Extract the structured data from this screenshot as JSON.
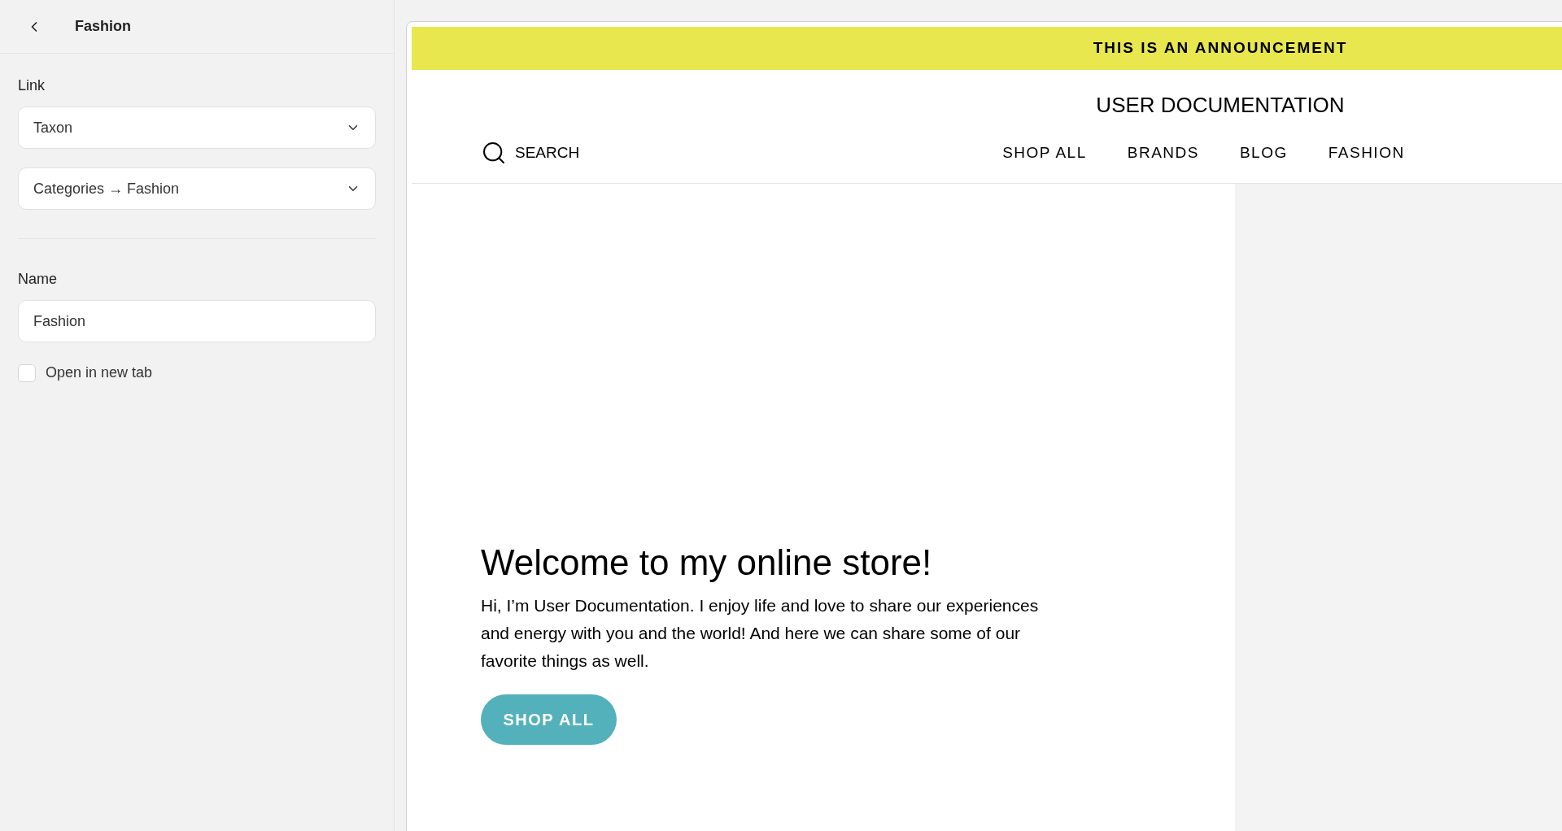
{
  "panel": {
    "title": "Fashion",
    "link_label": "Link",
    "link_type": "Taxon",
    "link_target": "Categories → Fashion",
    "name_label": "Name",
    "name_value": "Fashion",
    "new_tab": {
      "label": "Open in new tab",
      "checked": false
    }
  },
  "preview": {
    "announcement": "THIS IS AN ANNOUNCEMENT",
    "store_title": "USER DOCUMENTATION",
    "search": "SEARCH",
    "nav": [
      "SHOP ALL",
      "BRANDS",
      "BLOG",
      "FASHION"
    ],
    "hero": {
      "heading": "Welcome to my online store!",
      "text": "Hi, I’m User Documentation. I enjoy life and love to share our experiences and energy with you and the world! And here we can share some of our favorite things as well.",
      "button": "SHOP ALL"
    }
  }
}
